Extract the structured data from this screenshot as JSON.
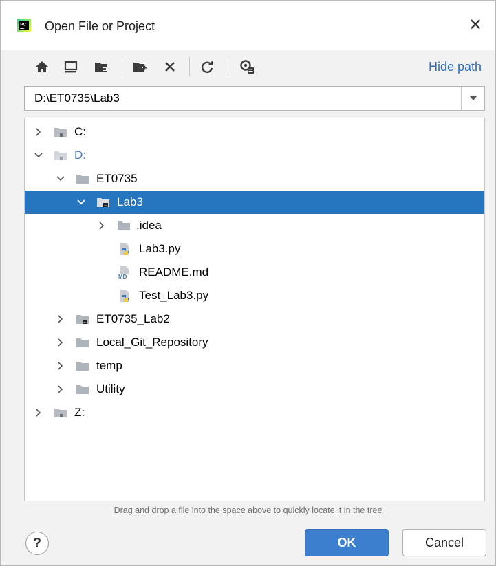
{
  "window": {
    "title": "Open File or Project",
    "app_icon": "pycharm-logo-icon"
  },
  "toolbar": {
    "buttons": [
      "home-icon",
      "desktop-icon",
      "project-folder-icon",
      "new-folder-icon",
      "delete-icon",
      "refresh-icon",
      "show-hidden-icon"
    ],
    "hide_path_label": "Hide path"
  },
  "path_field": {
    "value": "D:\\ET0735\\Lab3"
  },
  "tree": {
    "rows": [
      {
        "label": "C:",
        "kind": "drive",
        "expanded": false
      },
      {
        "label": "D:",
        "kind": "drive",
        "expanded": true
      },
      {
        "label": "ET0735",
        "kind": "folder",
        "expanded": true
      },
      {
        "label": "Lab3",
        "kind": "project-folder",
        "expanded": true,
        "selected": true
      },
      {
        "label": ".idea",
        "kind": "folder",
        "expanded": false
      },
      {
        "label": "Lab3.py",
        "kind": "python-file"
      },
      {
        "label": "README.md",
        "kind": "markdown-file"
      },
      {
        "label": "Test_Lab3.py",
        "kind": "python-file"
      },
      {
        "label": "ET0735_Lab2",
        "kind": "project-folder",
        "expanded": false
      },
      {
        "label": "Local_Git_Repository",
        "kind": "folder",
        "expanded": false
      },
      {
        "label": "temp",
        "kind": "folder",
        "expanded": false
      },
      {
        "label": "Utility",
        "kind": "folder",
        "expanded": false
      },
      {
        "label": "Z:",
        "kind": "drive",
        "expanded": false
      }
    ]
  },
  "hint_text": "Drag and drop a file into the space above to quickly locate it in the tree",
  "buttons": {
    "help": "?",
    "ok": "OK",
    "cancel": "Cancel"
  },
  "colors": {
    "selection": "#2675bf",
    "accent": "#3c7fce",
    "link": "#2f6fbe"
  }
}
